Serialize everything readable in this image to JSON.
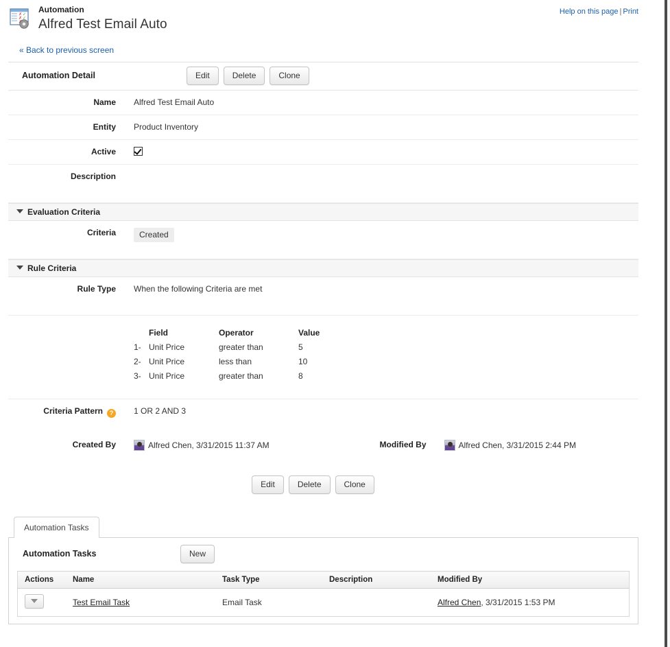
{
  "header": {
    "object_type": "Automation",
    "record_title": "Alfred Test Email Auto",
    "help_link": "Help on this page",
    "separator": "|",
    "print_link": "Print",
    "back_link": "« Back to previous screen",
    "app_icon": "automation-rules-icon"
  },
  "detail": {
    "panel_title": "Automation Detail",
    "buttons": {
      "edit": "Edit",
      "delete": "Delete",
      "clone": "Clone"
    },
    "fields": {
      "name_label": "Name",
      "name_value": "Alfred Test Email Auto",
      "entity_label": "Entity",
      "entity_value": "Product Inventory",
      "active_label": "Active",
      "active_checked": true,
      "description_label": "Description",
      "description_value": ""
    }
  },
  "evaluation_criteria": {
    "section_title": "Evaluation Criteria",
    "criteria_label": "Criteria",
    "criteria_value": "Created"
  },
  "rule_criteria": {
    "section_title": "Rule Criteria",
    "rule_type_label": "Rule Type",
    "rule_type_value": "When the following Criteria are met",
    "columns": {
      "field": "Field",
      "operator": "Operator",
      "value": "Value"
    },
    "rows": [
      {
        "index": "1-",
        "field": "Unit Price",
        "operator": "greater than",
        "value": "5"
      },
      {
        "index": "2-",
        "field": "Unit Price",
        "operator": "less than",
        "value": "10"
      },
      {
        "index": "3-",
        "field": "Unit Price",
        "operator": "greater than",
        "value": "8"
      }
    ],
    "pattern_label": "Criteria Pattern",
    "pattern_help_glyph": "?",
    "pattern_value": "1 OR 2 AND 3"
  },
  "audit": {
    "created_by_label": "Created By",
    "created_by_value": "Alfred Chen, 3/31/2015 11:37 AM",
    "modified_by_label": "Modified By",
    "modified_by_value": "Alfred Chen, 3/31/2015 2:44 PM"
  },
  "bottom_buttons": {
    "edit": "Edit",
    "delete": "Delete",
    "clone": "Clone"
  },
  "related_list": {
    "tab_label": "Automation Tasks",
    "title": "Automation Tasks",
    "new_button": "New",
    "columns": {
      "actions": "Actions",
      "name": "Name",
      "task_type": "Task Type",
      "description": "Description",
      "modified_by": "Modified By"
    },
    "rows": [
      {
        "action_icon": "chevron-down-icon",
        "name": "Test Email Task",
        "task_type": "Email Task",
        "description": "",
        "modified_by_user": "Alfred Chen",
        "modified_by_rest": ", 3/31/2015 1:53 PM"
      }
    ]
  },
  "colors": {
    "link": "#1b5faa",
    "help_badge": "#f5a623",
    "section_bg": "#f6f6f6",
    "page_bg": "#f7f7f7"
  }
}
